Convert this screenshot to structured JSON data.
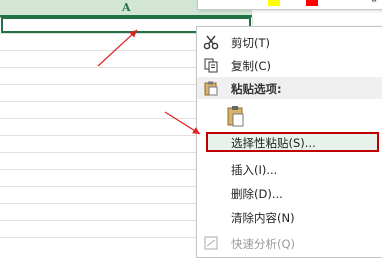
{
  "sheet": {
    "column_letter": "A"
  },
  "mini_toolbar": {
    "colors": [
      "#ffff00",
      "#ff0000"
    ]
  },
  "context_menu": {
    "cut": "剪切(T)",
    "copy": "复制(C)",
    "paste_options": "粘贴选项:",
    "paste_special": "选择性粘贴(S)...",
    "insert": "插入(I)...",
    "delete": "删除(D)...",
    "clear_contents": "清除内容(N)",
    "quick_analysis": "快速分析(Q)"
  },
  "colors": {
    "accent": "#217346",
    "highlight_border": "#c00000",
    "arrow": "#e02020"
  }
}
